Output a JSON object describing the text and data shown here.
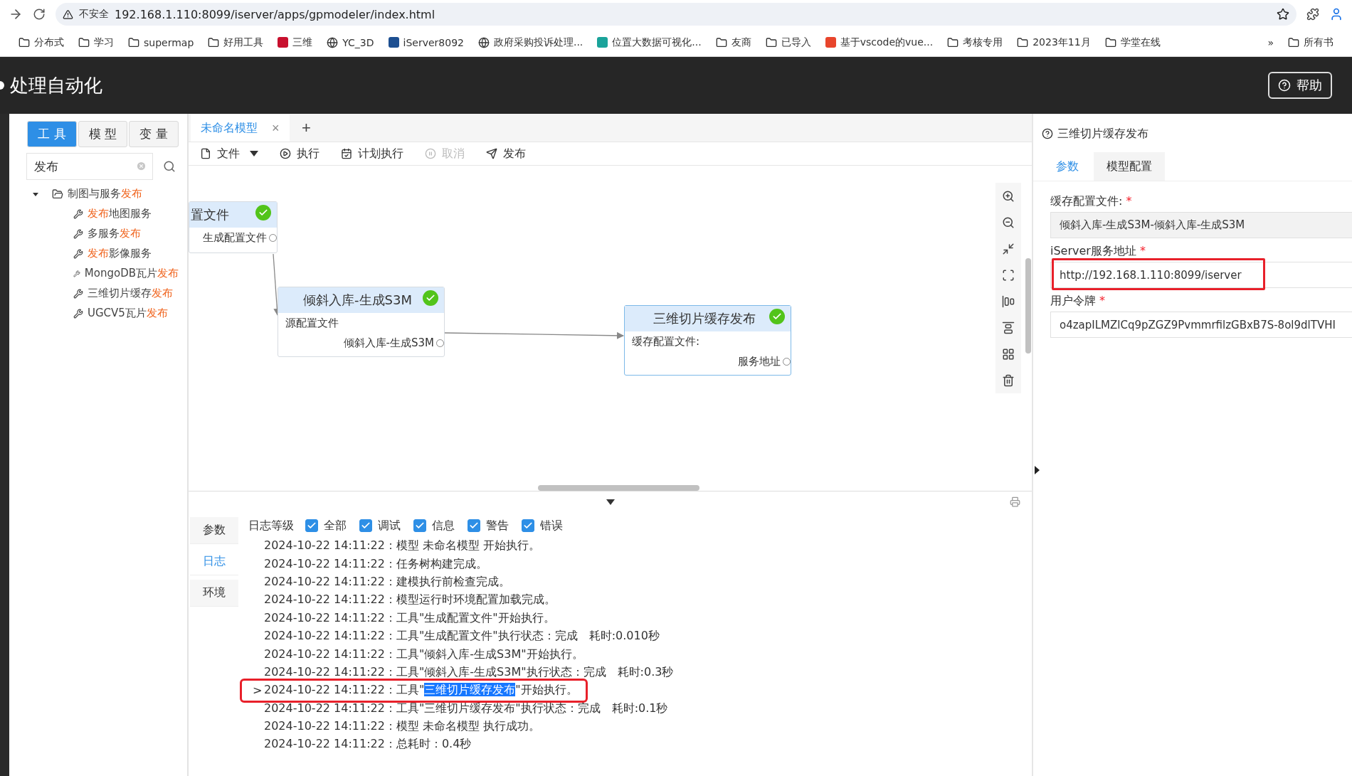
{
  "browser": {
    "security": "不安全",
    "url": "192.168.1.110:8099/iserver/apps/gpmodeler/index.html",
    "more": "»",
    "bookmarks": [
      {
        "label": "分布式",
        "kind": "folder"
      },
      {
        "label": "学习",
        "kind": "folder"
      },
      {
        "label": "supermap",
        "kind": "folder"
      },
      {
        "label": "好用工具",
        "kind": "folder"
      },
      {
        "label": "三维",
        "kind": "site",
        "color": "#c8102e"
      },
      {
        "label": "YC_3D",
        "kind": "globe"
      },
      {
        "label": "iServer8092",
        "kind": "site",
        "color": "#1d4f91"
      },
      {
        "label": "政府采购投诉处理...",
        "kind": "globe"
      },
      {
        "label": "位置大数据可视化...",
        "kind": "site",
        "color": "#1aa39a"
      },
      {
        "label": "友商",
        "kind": "folder"
      },
      {
        "label": "已导入",
        "kind": "folder"
      },
      {
        "label": "基于vscode的vue...",
        "kind": "site",
        "color": "#e8452c"
      },
      {
        "label": "考核专用",
        "kind": "folder"
      },
      {
        "label": "2023年11月",
        "kind": "folder"
      },
      {
        "label": "学堂在线",
        "kind": "folder"
      }
    ],
    "overflow_folder": "所有书"
  },
  "header": {
    "title": "处理自动化",
    "help": "帮助"
  },
  "left": {
    "tabs": [
      {
        "label": "工 具",
        "selected": true
      },
      {
        "label": "模 型",
        "selected": false
      },
      {
        "label": "变 量",
        "selected": false
      }
    ],
    "search": {
      "value": "发布"
    },
    "tree": [
      {
        "parts": [
          {
            "text": "制图与服务",
            "hit": false
          },
          {
            "text": "发布",
            "hit": true
          }
        ],
        "expanded": true,
        "children": [
          {
            "parts": [
              {
                "text": "发布",
                "hit": true
              },
              {
                "text": "地图服务",
                "hit": false
              }
            ]
          },
          {
            "parts": [
              {
                "text": "多服务",
                "hit": false
              },
              {
                "text": "发布",
                "hit": true
              }
            ]
          },
          {
            "parts": [
              {
                "text": "发布",
                "hit": true
              },
              {
                "text": "影像服务",
                "hit": false
              }
            ]
          },
          {
            "parts": [
              {
                "text": "MongoDB瓦片",
                "hit": false
              },
              {
                "text": "发布",
                "hit": true
              }
            ]
          },
          {
            "parts": [
              {
                "text": "三维切片缓存",
                "hit": false
              },
              {
                "text": "发布",
                "hit": true
              }
            ]
          },
          {
            "parts": [
              {
                "text": "UGCV5瓦片",
                "hit": false
              },
              {
                "text": "发布",
                "hit": true
              }
            ]
          }
        ]
      }
    ]
  },
  "editor_tabs": [
    {
      "label": "未命名模型",
      "selected": true,
      "close": "×"
    }
  ],
  "add_tab": "+",
  "toolbar": [
    {
      "label": "文件",
      "kind": "file",
      "disabled": false,
      "dropdown": true
    },
    {
      "label": "执行",
      "kind": "run",
      "disabled": false,
      "dropdown": false
    },
    {
      "label": "计划执行",
      "kind": "schedule",
      "disabled": false,
      "dropdown": false
    },
    {
      "label": "取消",
      "kind": "cancel",
      "disabled": true,
      "dropdown": false
    },
    {
      "label": "发布",
      "kind": "publish",
      "disabled": false,
      "dropdown": false
    }
  ],
  "nodes": [
    {
      "title": "置文件",
      "done": true,
      "selected": false,
      "outputs": [
        "生成配置文件"
      ]
    },
    {
      "title": "倾斜入库-生成S3M",
      "done": true,
      "selected": false,
      "inputs": [
        "源配置文件"
      ],
      "outputs": [
        "倾斜入库-生成S3M"
      ]
    },
    {
      "title": "三维切片缓存发布",
      "done": true,
      "selected": true,
      "inputs": [
        "缓存配置文件:"
      ],
      "outputs": [
        "服务地址"
      ]
    }
  ],
  "log_panel": {
    "tabs": [
      {
        "label": "参数",
        "selected": false
      },
      {
        "label": "日志",
        "selected": true
      },
      {
        "label": "环境",
        "selected": false
      }
    ],
    "level_label": "日志等级",
    "levels": [
      {
        "label": "全部",
        "checked": true
      },
      {
        "label": "调试",
        "checked": true
      },
      {
        "label": "信息",
        "checked": true
      },
      {
        "label": "警告",
        "checked": true
      },
      {
        "label": "错误",
        "checked": true
      }
    ],
    "lines": [
      {
        "selected": false,
        "parts": [
          {
            "text": "2024-10-22 14:11:22：模型 未命名模型 开始执行。",
            "highlighted": false
          }
        ]
      },
      {
        "selected": false,
        "parts": [
          {
            "text": "2024-10-22 14:11:22：任务树构建完成。",
            "highlighted": false
          }
        ]
      },
      {
        "selected": false,
        "parts": [
          {
            "text": "2024-10-22 14:11:22：建模执行前检查完成。",
            "highlighted": false
          }
        ]
      },
      {
        "selected": false,
        "parts": [
          {
            "text": "2024-10-22 14:11:22：模型运行时环境配置加载完成。",
            "highlighted": false
          }
        ]
      },
      {
        "selected": false,
        "parts": [
          {
            "text": "2024-10-22 14:11:22：工具\"生成配置文件\"开始执行。",
            "highlighted": false
          }
        ]
      },
      {
        "selected": false,
        "parts": [
          {
            "text": "2024-10-22 14:11:22：工具\"生成配置文件\"执行状态：完成　耗时:0.010秒",
            "highlighted": false
          }
        ]
      },
      {
        "selected": false,
        "parts": [
          {
            "text": "2024-10-22 14:11:22：工具\"倾斜入库-生成S3M\"开始执行。",
            "highlighted": false
          }
        ]
      },
      {
        "selected": false,
        "parts": [
          {
            "text": "2024-10-22 14:11:22：工具\"倾斜入库-生成S3M\"执行状态：完成　耗时:0.3秒",
            "highlighted": false
          }
        ]
      },
      {
        "selected": true,
        "marker": ">",
        "parts": [
          {
            "text": "2024-10-22 14:11:22：工具\"",
            "highlighted": false
          },
          {
            "text": "三维切片缓存发布",
            "highlighted": true
          },
          {
            "text": "\"开始执行。",
            "highlighted": false
          }
        ]
      },
      {
        "selected": false,
        "parts": [
          {
            "text": "2024-10-22 14:11:22：工具\"三维切片缓存发布\"执行状态：完成　耗时:0.1秒",
            "highlighted": false
          }
        ]
      },
      {
        "selected": false,
        "parts": [
          {
            "text": "2024-10-22 14:11:22：模型 未命名模型 执行成功。",
            "highlighted": false
          }
        ]
      },
      {
        "selected": false,
        "parts": [
          {
            "text": "2024-10-22 14:11:22：总耗时：0.4秒",
            "highlighted": false
          }
        ]
      }
    ]
  },
  "right": {
    "title": "三维切片缓存发布",
    "tabs": [
      {
        "label": "参数",
        "selected": true
      },
      {
        "label": "模型配置",
        "selected": false
      }
    ],
    "fields": [
      {
        "label": "缓存配置文件:",
        "required": true,
        "required_mark": "*",
        "value": "倾斜入库-生成S3M-倾斜入库-生成S3M",
        "readonly": true,
        "highlighted": false
      },
      {
        "label": "iServer服务地址",
        "required": true,
        "required_mark": "*",
        "value": "http://192.168.1.110:8099/iserver",
        "readonly": false,
        "highlighted": true
      },
      {
        "label": "用户令牌",
        "required": true,
        "required_mark": "*",
        "value": "o4zapILMZlCq9pZGZ9PvmmrfilzGBxB7S-8ol9dlTVHI",
        "readonly": false,
        "highlighted": false
      }
    ]
  }
}
